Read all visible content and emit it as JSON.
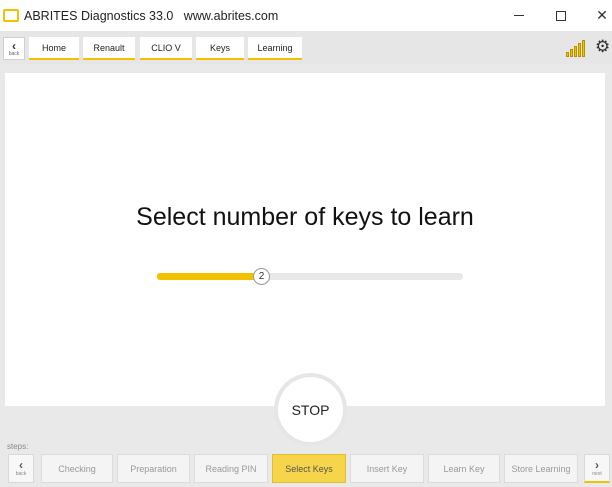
{
  "window": {
    "title": "ABRITES Diagnostics 33.0",
    "url": "www.abrites.com",
    "minimize_icon": "minimize-icon",
    "maximize_icon": "maximize-icon",
    "close_glyph": "✕"
  },
  "nav": {
    "back_label": "back",
    "breadcrumbs": [
      "Home",
      "Renault",
      "CLIO V",
      "Keys",
      "Learning"
    ],
    "signal_icon": "signal-bars-icon",
    "settings_icon": "gear-icon"
  },
  "main": {
    "heading": "Select number of keys to learn",
    "slider": {
      "value": "2",
      "fill_fraction": 0.34
    },
    "stop_label": "STOP"
  },
  "steps": {
    "label": "steps:",
    "back_label": "back",
    "next_label": "next",
    "items": [
      "Checking",
      "Preparation",
      "Reading PIN",
      "Select Keys",
      "Insert Key",
      "Learn Key",
      "Store Learning"
    ],
    "active_index": 3
  },
  "colors": {
    "accent": "#f2c200",
    "active_step": "#f7d54a"
  }
}
